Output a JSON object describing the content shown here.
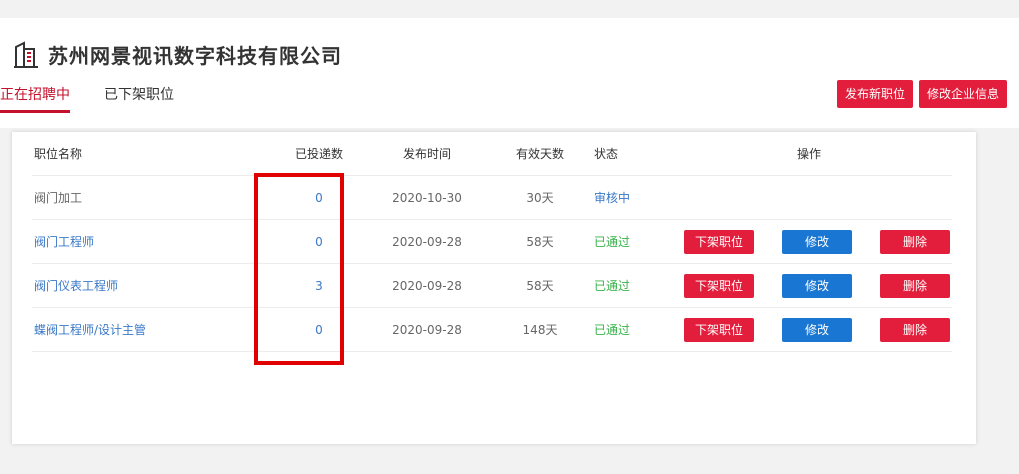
{
  "company": {
    "name": "苏州网景视讯数字科技有限公司"
  },
  "tabs": [
    {
      "label": "正在招聘中",
      "active": true
    },
    {
      "label": "已下架职位",
      "active": false
    }
  ],
  "actions": {
    "publish_label": "发布新职位",
    "edit_company_label": "修改企业信息"
  },
  "table": {
    "headers": {
      "name": "职位名称",
      "count": "已投递数",
      "date": "发布时间",
      "days": "有效天数",
      "status": "状态",
      "ops": "操作"
    },
    "rows": [
      {
        "name": "阀门加工",
        "count": "0",
        "date": "2020-10-30",
        "days": "30天",
        "status": "审核中"
      },
      {
        "name": "阀门工程师",
        "count": "0",
        "date": "2020-09-28",
        "days": "58天",
        "status": "已通过",
        "off": "下架职位",
        "edit": "修改",
        "del": "删除"
      },
      {
        "name": "阀门仪表工程师",
        "count": "3",
        "date": "2020-09-28",
        "days": "58天",
        "status": "已通过",
        "off": "下架职位",
        "edit": "修改",
        "del": "删除"
      },
      {
        "name": "蝶阀工程师/设计主管",
        "count": "0",
        "date": "2020-09-28",
        "days": "148天",
        "status": "已通过",
        "off": "下架职位",
        "edit": "修改",
        "del": "删除"
      }
    ]
  },
  "colors": {
    "brand_red": "#e21e3c",
    "edit_blue": "#1976d2",
    "link_blue": "#3a78c8",
    "pass_green": "#38b24a",
    "highlight": "#e00000"
  }
}
